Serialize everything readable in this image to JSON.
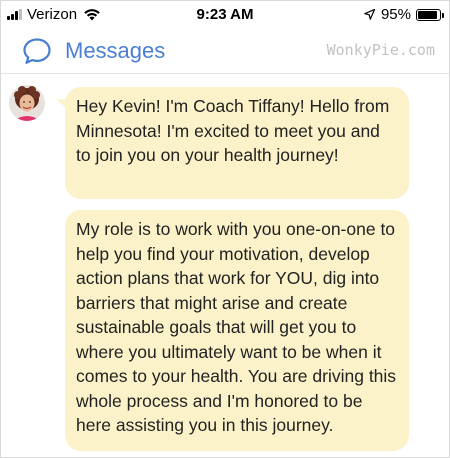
{
  "status_bar": {
    "carrier": "Verizon",
    "time": "9:23 AM",
    "battery_percent_text": "95%",
    "battery_level": 0.95,
    "icons": [
      "signal-bars",
      "wifi-icon",
      "location-arrow-icon",
      "battery-icon"
    ]
  },
  "header": {
    "title": "Messages",
    "watermark": "WonkyPie.com",
    "icon": "chat-bubble-icon",
    "accent_color": "#4a7fd0"
  },
  "messages": [
    {
      "sender": "Coach Tiffany",
      "avatar_icon": "avatar",
      "text": "Hey Kevin! I'm Coach Tiffany! Hello from Minnesota! I'm excited to meet you and to join you on your health journey!"
    },
    {
      "sender": "Coach Tiffany",
      "text": "My role is to work with you one-on-one to help you find your motivation, develop action plans that work for YOU, dig into barriers that might arise and create sustainable goals that will get you to where you ultimately want to be when it comes to your health. You are driving this whole process and I'm honored to be here assisting you in this journey."
    }
  ],
  "colors": {
    "bubble": "#fcf2c9",
    "text": "#222222"
  }
}
